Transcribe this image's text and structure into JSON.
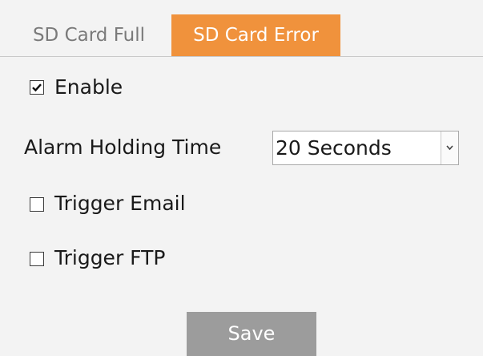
{
  "tabs": [
    {
      "label": "SD Card Full",
      "active": false
    },
    {
      "label": "SD Card Error",
      "active": true
    }
  ],
  "form": {
    "enable": {
      "label": "Enable",
      "checked": true
    },
    "alarm_holding_time": {
      "label": "Alarm Holding Time",
      "value": "20 Seconds"
    },
    "trigger_email": {
      "label": "Trigger Email",
      "checked": false
    },
    "trigger_ftp": {
      "label": "Trigger FTP",
      "checked": false
    }
  },
  "actions": {
    "save_label": "Save"
  },
  "colors": {
    "active_tab": "#f0923c",
    "background": "#f3f3f3",
    "save_button": "#9c9c9c"
  }
}
